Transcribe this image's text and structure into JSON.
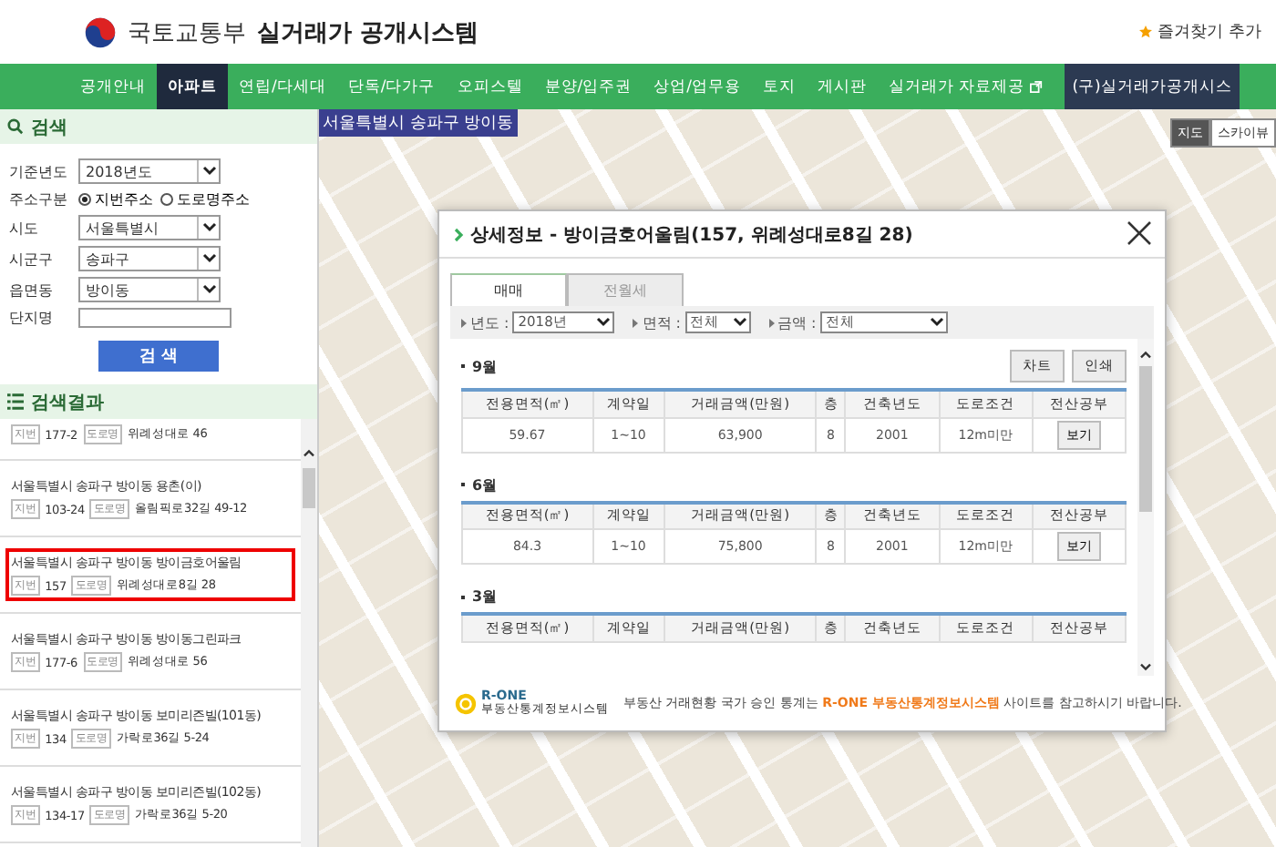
{
  "header": {
    "ministry": "국토교통부",
    "system": "실거래가 공개시스템",
    "favorite": "즐겨찾기 추가"
  },
  "nav": [
    {
      "label": "공개안내",
      "selected": false,
      "kind": "menu"
    },
    {
      "label": "아파트",
      "selected": true,
      "kind": "menu"
    },
    {
      "label": "연립/다세대",
      "selected": false,
      "kind": "menu"
    },
    {
      "label": "단독/다가구",
      "selected": false,
      "kind": "menu"
    },
    {
      "label": "오피스텔",
      "selected": false,
      "kind": "menu"
    },
    {
      "label": "분양/입주권",
      "selected": false,
      "kind": "menu"
    },
    {
      "label": "상업/업무용",
      "selected": false,
      "kind": "menu"
    },
    {
      "label": "토지",
      "selected": false,
      "kind": "menu"
    },
    {
      "label": "게시판",
      "selected": false,
      "kind": "menu"
    },
    {
      "label": "실거래가 자료제공",
      "selected": false,
      "kind": "external"
    },
    {
      "label": "(구)실거래가공개시스",
      "selected": false,
      "kind": "legacy"
    }
  ],
  "search": {
    "title": "검색",
    "fields": [
      {
        "label": "기준년도",
        "kind": "select",
        "value": "2018년도"
      },
      {
        "label": "주소구분",
        "kind": "radio",
        "options": [
          {
            "label": "지번주소",
            "selected": true
          },
          {
            "label": "도로명주소",
            "selected": false
          }
        ]
      },
      {
        "label": "시도",
        "kind": "select",
        "value": "서울특별시"
      },
      {
        "label": "시군구",
        "kind": "select",
        "value": "송파구"
      },
      {
        "label": "읍면동",
        "kind": "select",
        "value": "방이동"
      },
      {
        "label": "단지명",
        "kind": "text"
      }
    ],
    "button": "검 색"
  },
  "results": {
    "title": "검색결과",
    "items": [
      {
        "lot_tag": "지번",
        "lot": "177-2",
        "road_tag": "도로명",
        "road": "위례성대로 46",
        "highlighted": false
      },
      {
        "title": "서울특별시 송파구 방이동 용촌(이)",
        "lot_tag": "지번",
        "lot": "103-24",
        "road_tag": "도로명",
        "road": "올림픽로32길 49-12",
        "highlighted": false
      },
      {
        "title": "서울특별시 송파구 방이동 방이금호어울림",
        "lot_tag": "지번",
        "lot": "157",
        "road_tag": "도로명",
        "road": "위례성대로8길 28",
        "highlighted": true
      },
      {
        "title": "서울특별시 송파구 방이동 방이동그린파크",
        "lot_tag": "지번",
        "lot": "177-6",
        "road_tag": "도로명",
        "road": "위례성대로 56",
        "highlighted": false
      },
      {
        "title": "서울특별시 송파구 방이동 보미리즌빌(101동)",
        "lot_tag": "지번",
        "lot": "134",
        "road_tag": "도로명",
        "road": "가락로36길 5-24",
        "highlighted": false
      },
      {
        "title": "서울특별시 송파구 방이동 보미리즌빌(102동)",
        "lot_tag": "지번",
        "lot": "134-17",
        "road_tag": "도로명",
        "road": "가락로36길 5-20",
        "highlighted": false
      }
    ]
  },
  "map": {
    "location": "서울특별시 송파구 방이동",
    "view_tabs": [
      {
        "label": "지도",
        "selected": true
      },
      {
        "label": "스카이뷰",
        "selected": false
      }
    ]
  },
  "detail": {
    "title": "상세정보 - 방이금호어울림(157, 위례성대로8길 28)",
    "tabs": [
      {
        "label": "매매",
        "selected": true
      },
      {
        "label": "전월세",
        "selected": false
      }
    ],
    "filters": [
      {
        "label": "년도 :",
        "value": "2018년"
      },
      {
        "label": "면적 :",
        "value": "전체"
      },
      {
        "label": "금액 :",
        "value": "전체"
      }
    ],
    "buttons": [
      "차트",
      "인쇄"
    ],
    "months": [
      {
        "label": "9월",
        "columns": [
          "전용면적(㎡)",
          "계약일",
          "거래금액(만원)",
          "층",
          "건축년도",
          "도로조건",
          "전산공부"
        ],
        "rows": [
          [
            "59.67",
            "1~10",
            "63,900",
            "8",
            "2001",
            "12m미만",
            "보기"
          ]
        ]
      },
      {
        "label": "6월",
        "columns": [
          "전용면적(㎡)",
          "계약일",
          "거래금액(만원)",
          "층",
          "건축년도",
          "도로조건",
          "전산공부"
        ],
        "rows": [
          [
            "84.3",
            "1~10",
            "75,800",
            "8",
            "2001",
            "12m미만",
            "보기"
          ]
        ]
      },
      {
        "label": "3월",
        "columns": [
          "전용면적(㎡)",
          "계약일",
          "거래금액(만원)",
          "층",
          "건축년도",
          "도로조건",
          "전산공부"
        ]
      }
    ],
    "footer": {
      "logo_top": "R-ONE",
      "logo_bottom": "부동산통계정보시스템",
      "notice": "부동산 거래현황 국가 승인 통계는 **R-ONE 부동산통계정보시스템** 사이트를 참고하시기 바랍니다."
    }
  }
}
